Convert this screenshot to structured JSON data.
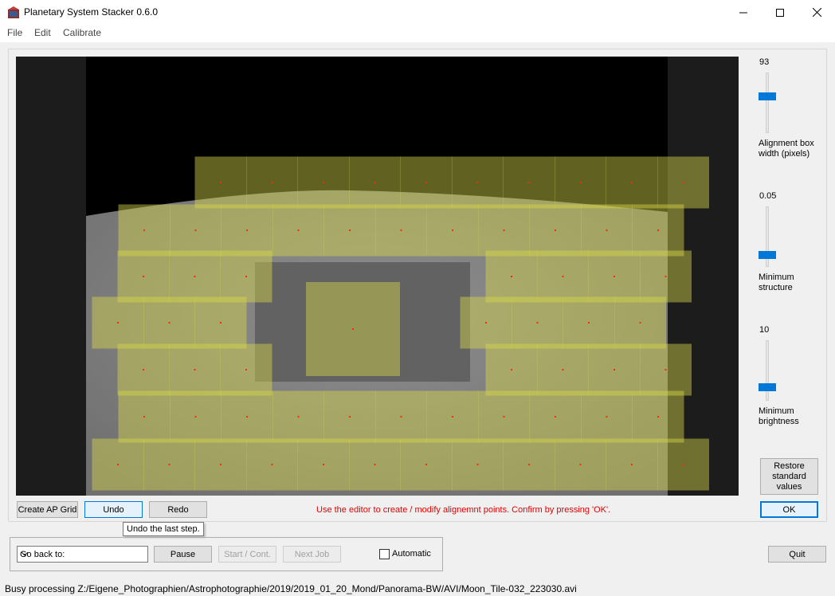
{
  "window": {
    "title": "Planetary System Stacker 0.6.0"
  },
  "menu": [
    "File",
    "Edit",
    "Calibrate"
  ],
  "sliders": [
    {
      "value": "93",
      "label_line1": "Alignment box",
      "label_line2": "width (pixels)"
    },
    {
      "value": "0.05",
      "label_line1": "Minimum",
      "label_line2": "structure"
    },
    {
      "value": "10",
      "label_line1": "Minimum",
      "label_line2": "brightness"
    }
  ],
  "buttons": {
    "restore_line1": "Restore",
    "restore_line2": "standard",
    "restore_line3": "values",
    "create_ap_grid": "Create AP Grid",
    "undo": "Undo",
    "redo": "Redo",
    "ok": "OK",
    "pause": "Pause",
    "start_cont": "Start / Cont.",
    "next_job": "Next Job",
    "quit": "Quit"
  },
  "message": "Use the editor to create / modify alignemnt points. Confirm by pressing 'OK'.",
  "tooltip": "Undo the last step.",
  "go_back": {
    "value": "Go back to:"
  },
  "automatic": {
    "label": "Automatic",
    "checked": false
  },
  "status": "Busy processing Z:/Eigene_Photographien/Astrophotographie/2019/2019_01_20_Mond/Panorama-BW/AVI/Moon_Tile-032_223030.avi",
  "colors": {
    "accent": "#0078d7",
    "message": "#e00000",
    "overlay": "#d8d84a"
  }
}
